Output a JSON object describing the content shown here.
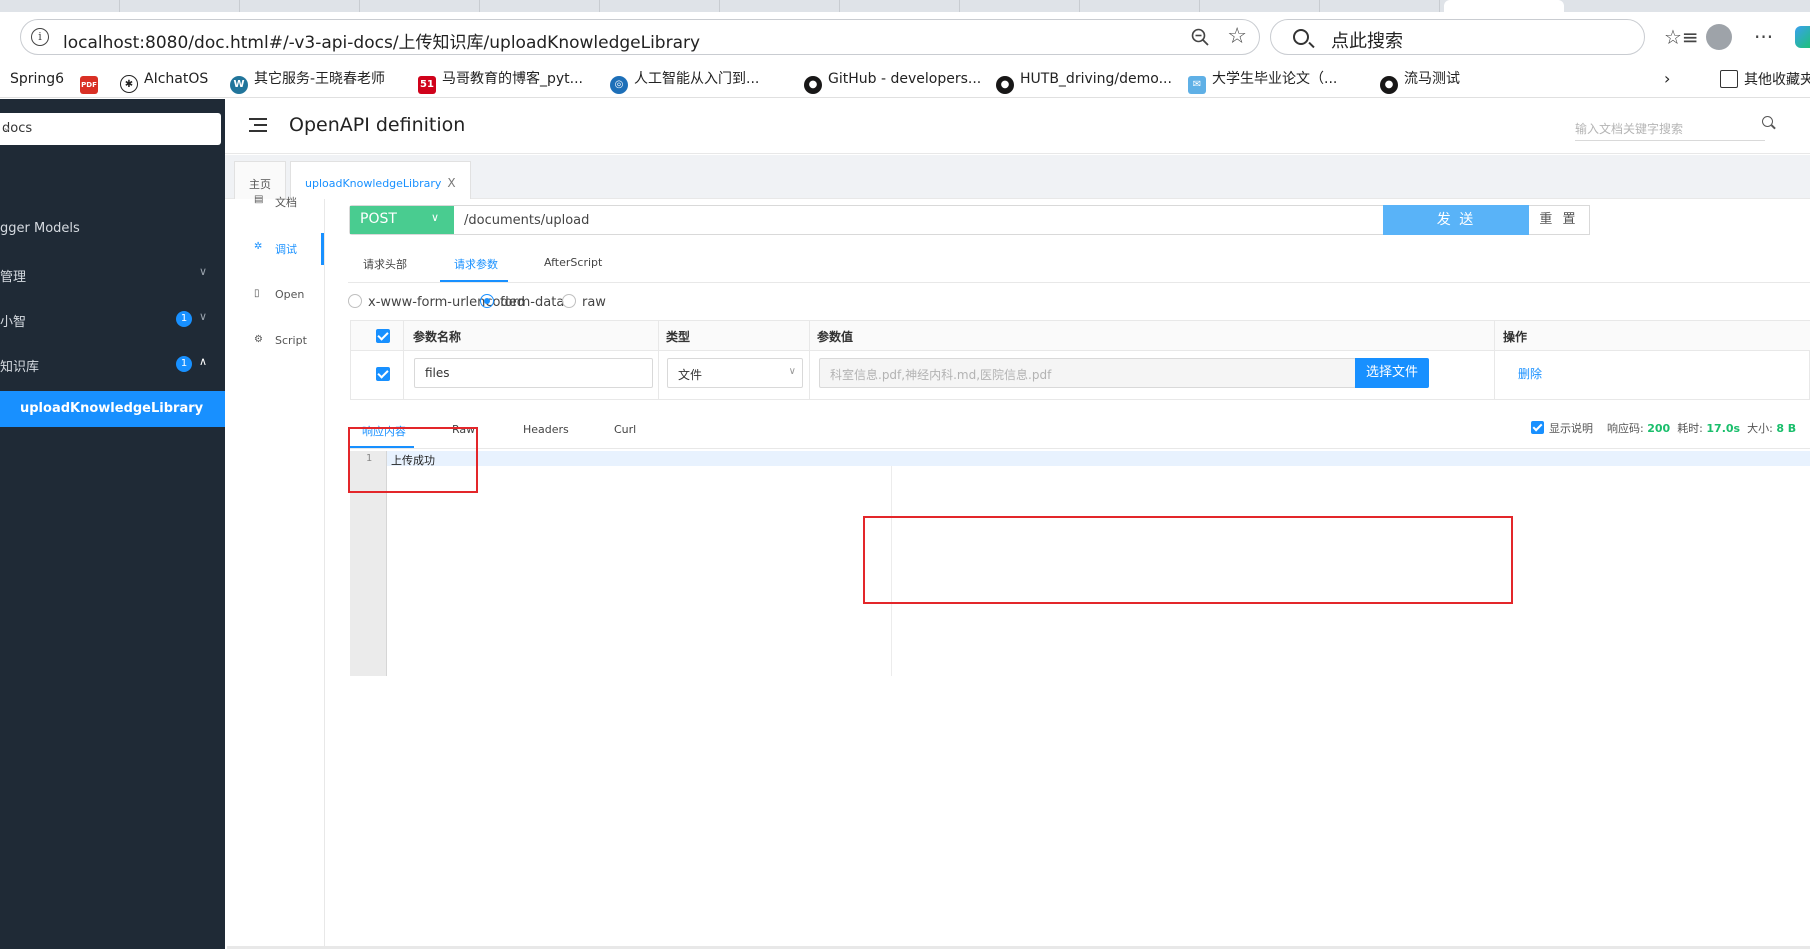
{
  "browser": {
    "url": "localhost:8080/doc.html#/-v3-api-docs/上传知识库/uploadKnowledgeLibrary",
    "search_placeholder": "点此搜索",
    "more_label": "···"
  },
  "bookmarks": [
    {
      "label": "Spring6",
      "icon": "none"
    },
    {
      "label": "AIchatOS",
      "icon": "openai-icon"
    },
    {
      "label": "其它服务-王晓春老师",
      "icon": "wordpress-icon"
    },
    {
      "label": "马哥教育的博客_pyt...",
      "icon": "51cto-icon"
    },
    {
      "label": "人工智能从入门到...",
      "icon": "circle-logo-icon"
    },
    {
      "label": "GitHub - developers...",
      "icon": "github-icon"
    },
    {
      "label": "HUTB_driving/demo...",
      "icon": "github-icon"
    },
    {
      "label": "大学生毕业论文（...",
      "icon": "mail-icon"
    },
    {
      "label": "流马测试",
      "icon": "github-icon"
    },
    {
      "label": "其他收藏夹",
      "icon": "folder-icon"
    }
  ],
  "sidebar": {
    "group_select": "docs",
    "items": [
      {
        "label": "gger Models"
      },
      {
        "label": "管理"
      },
      {
        "label": "小智",
        "badge": "1"
      },
      {
        "label": "知识库",
        "badge": "1"
      }
    ],
    "active_item": "uploadKnowledgeLibrary"
  },
  "header": {
    "title": "OpenAPI definition",
    "search_placeholder": "输入文档关键字搜索"
  },
  "page_tabs": [
    {
      "label": "主页"
    },
    {
      "label": "uploadKnowledgeLibrary",
      "close": "X"
    }
  ],
  "left_nav": [
    {
      "label": "文档"
    },
    {
      "label": "调试"
    },
    {
      "label": "Open"
    },
    {
      "label": "Script"
    }
  ],
  "request": {
    "method": "POST",
    "path": "/documents/upload",
    "send_label": "发 送",
    "reset_label": "重 置",
    "tabs": [
      "请求头部",
      "请求参数",
      "AfterScript"
    ],
    "body_types": [
      "x-www-form-urlencoded",
      "form-data",
      "raw"
    ],
    "selected_body_type": "form-data"
  },
  "params_table": {
    "headers": [
      "参数名称",
      "类型",
      "参数值",
      "操作"
    ],
    "rows": [
      {
        "name": "files",
        "type": "文件",
        "value": "科室信息.pdf,神经内科.md,医院信息.pdf",
        "choose_label": "选择文件",
        "action": "删除"
      }
    ]
  },
  "response": {
    "tabs": [
      "响应内容",
      "Raw",
      "Headers",
      "Curl"
    ],
    "show_desc_label": "显示说明",
    "status_label": "响应码:",
    "status_value": "200",
    "time_label": "耗时:",
    "time_value": "17.0s",
    "size_label": "大小:",
    "size_value": "8 B",
    "lines": [
      {
        "num": "1",
        "text": "上传成功"
      }
    ]
  },
  "colors": {
    "sidebar_bg": "#1f2a36",
    "primary": "#1890ff",
    "post_green": "#49cc90",
    "annotation_red": "#e3262a"
  }
}
